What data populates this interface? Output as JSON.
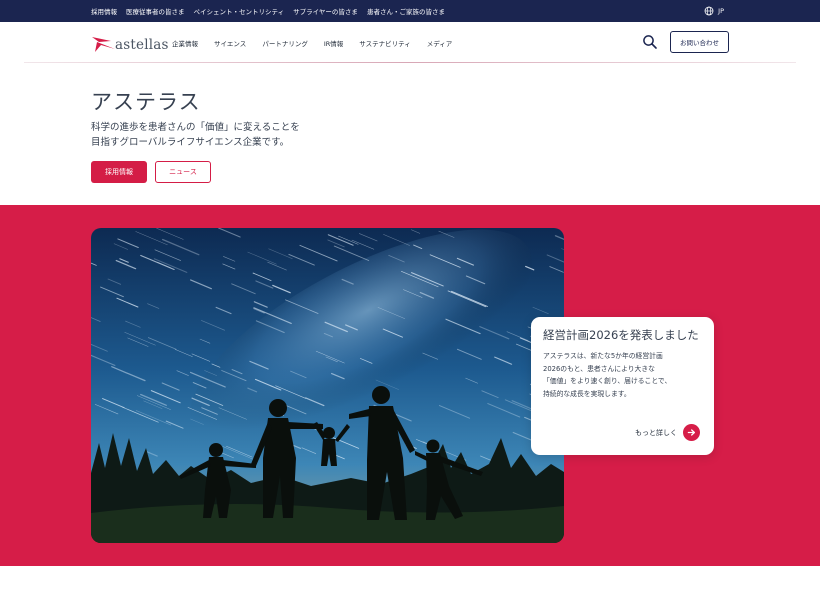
{
  "utility_bar": {
    "links": [
      "採用情報",
      "医療従事者の皆さま",
      "ペイシェント・セントリシティ",
      "サプライヤーの皆さま",
      "患者さん・ご家族の皆さま"
    ],
    "language": "JP"
  },
  "header": {
    "logo_text": "astellas",
    "nav": [
      "企業情報",
      "サイエンス",
      "パートナリング",
      "IR情報",
      "サステナビリティ",
      "メディア"
    ],
    "contact_label": "お問い合わせ"
  },
  "hero": {
    "title": "アステラス",
    "desc_line1": "科学の進歩を患者さんの「価値」に変えることを",
    "desc_line2": "目指すグローバルライフサイエンス企業です。",
    "primary_button": "採用情報",
    "secondary_button": "ニュース"
  },
  "feature": {
    "card_title": "経営計画2026を発表しました",
    "body_lines": [
      "アステラスは、新たな5か年の経営計画",
      "2026のもと、患者さんにより大きな",
      "「価値」をより速く創り、届けることで、",
      "持続的な成長を実現します。"
    ],
    "more_label": "もっと詳しく"
  },
  "colors": {
    "navy": "#1b2550",
    "brand_red": "#d61d48"
  }
}
